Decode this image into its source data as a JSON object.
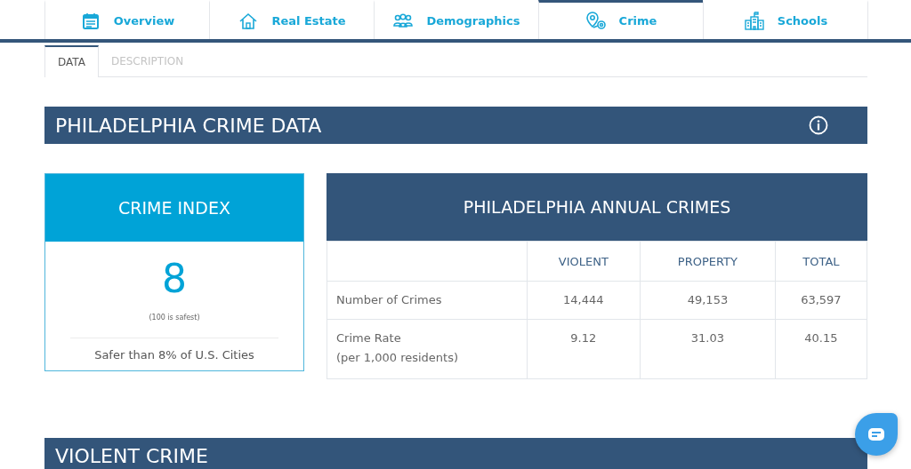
{
  "nav_tabs": [
    {
      "label": "Overview",
      "selected": false
    },
    {
      "label": "Real Estate",
      "selected": false
    },
    {
      "label": "Demographics",
      "selected": false
    },
    {
      "label": "Crime",
      "selected": true
    },
    {
      "label": "Schools",
      "selected": false
    }
  ],
  "sub_tabs": [
    {
      "label": "DATA",
      "selected": true
    },
    {
      "label": "DESCRIPTION",
      "selected": false
    }
  ],
  "section_title": "PHILADELPHIA CRIME DATA",
  "crime_index": {
    "title": "CRIME INDEX",
    "value": "8",
    "note": "(100 is safest)",
    "comparison": "Safer than 8% of U.S. Cities"
  },
  "annual_crimes": {
    "title": "PHILADELPHIA ANNUAL CRIMES",
    "columns": [
      "VIOLENT",
      "PROPERTY",
      "TOTAL"
    ],
    "rows": [
      {
        "label": "Number of Crimes",
        "values": [
          "14,444",
          "49,153",
          "63,597"
        ]
      },
      {
        "label": "Crime Rate\n(per 1,000 residents)",
        "values": [
          "9.12",
          "31.03",
          "40.15"
        ]
      }
    ]
  },
  "next_section_title": "VIOLENT CRIME"
}
